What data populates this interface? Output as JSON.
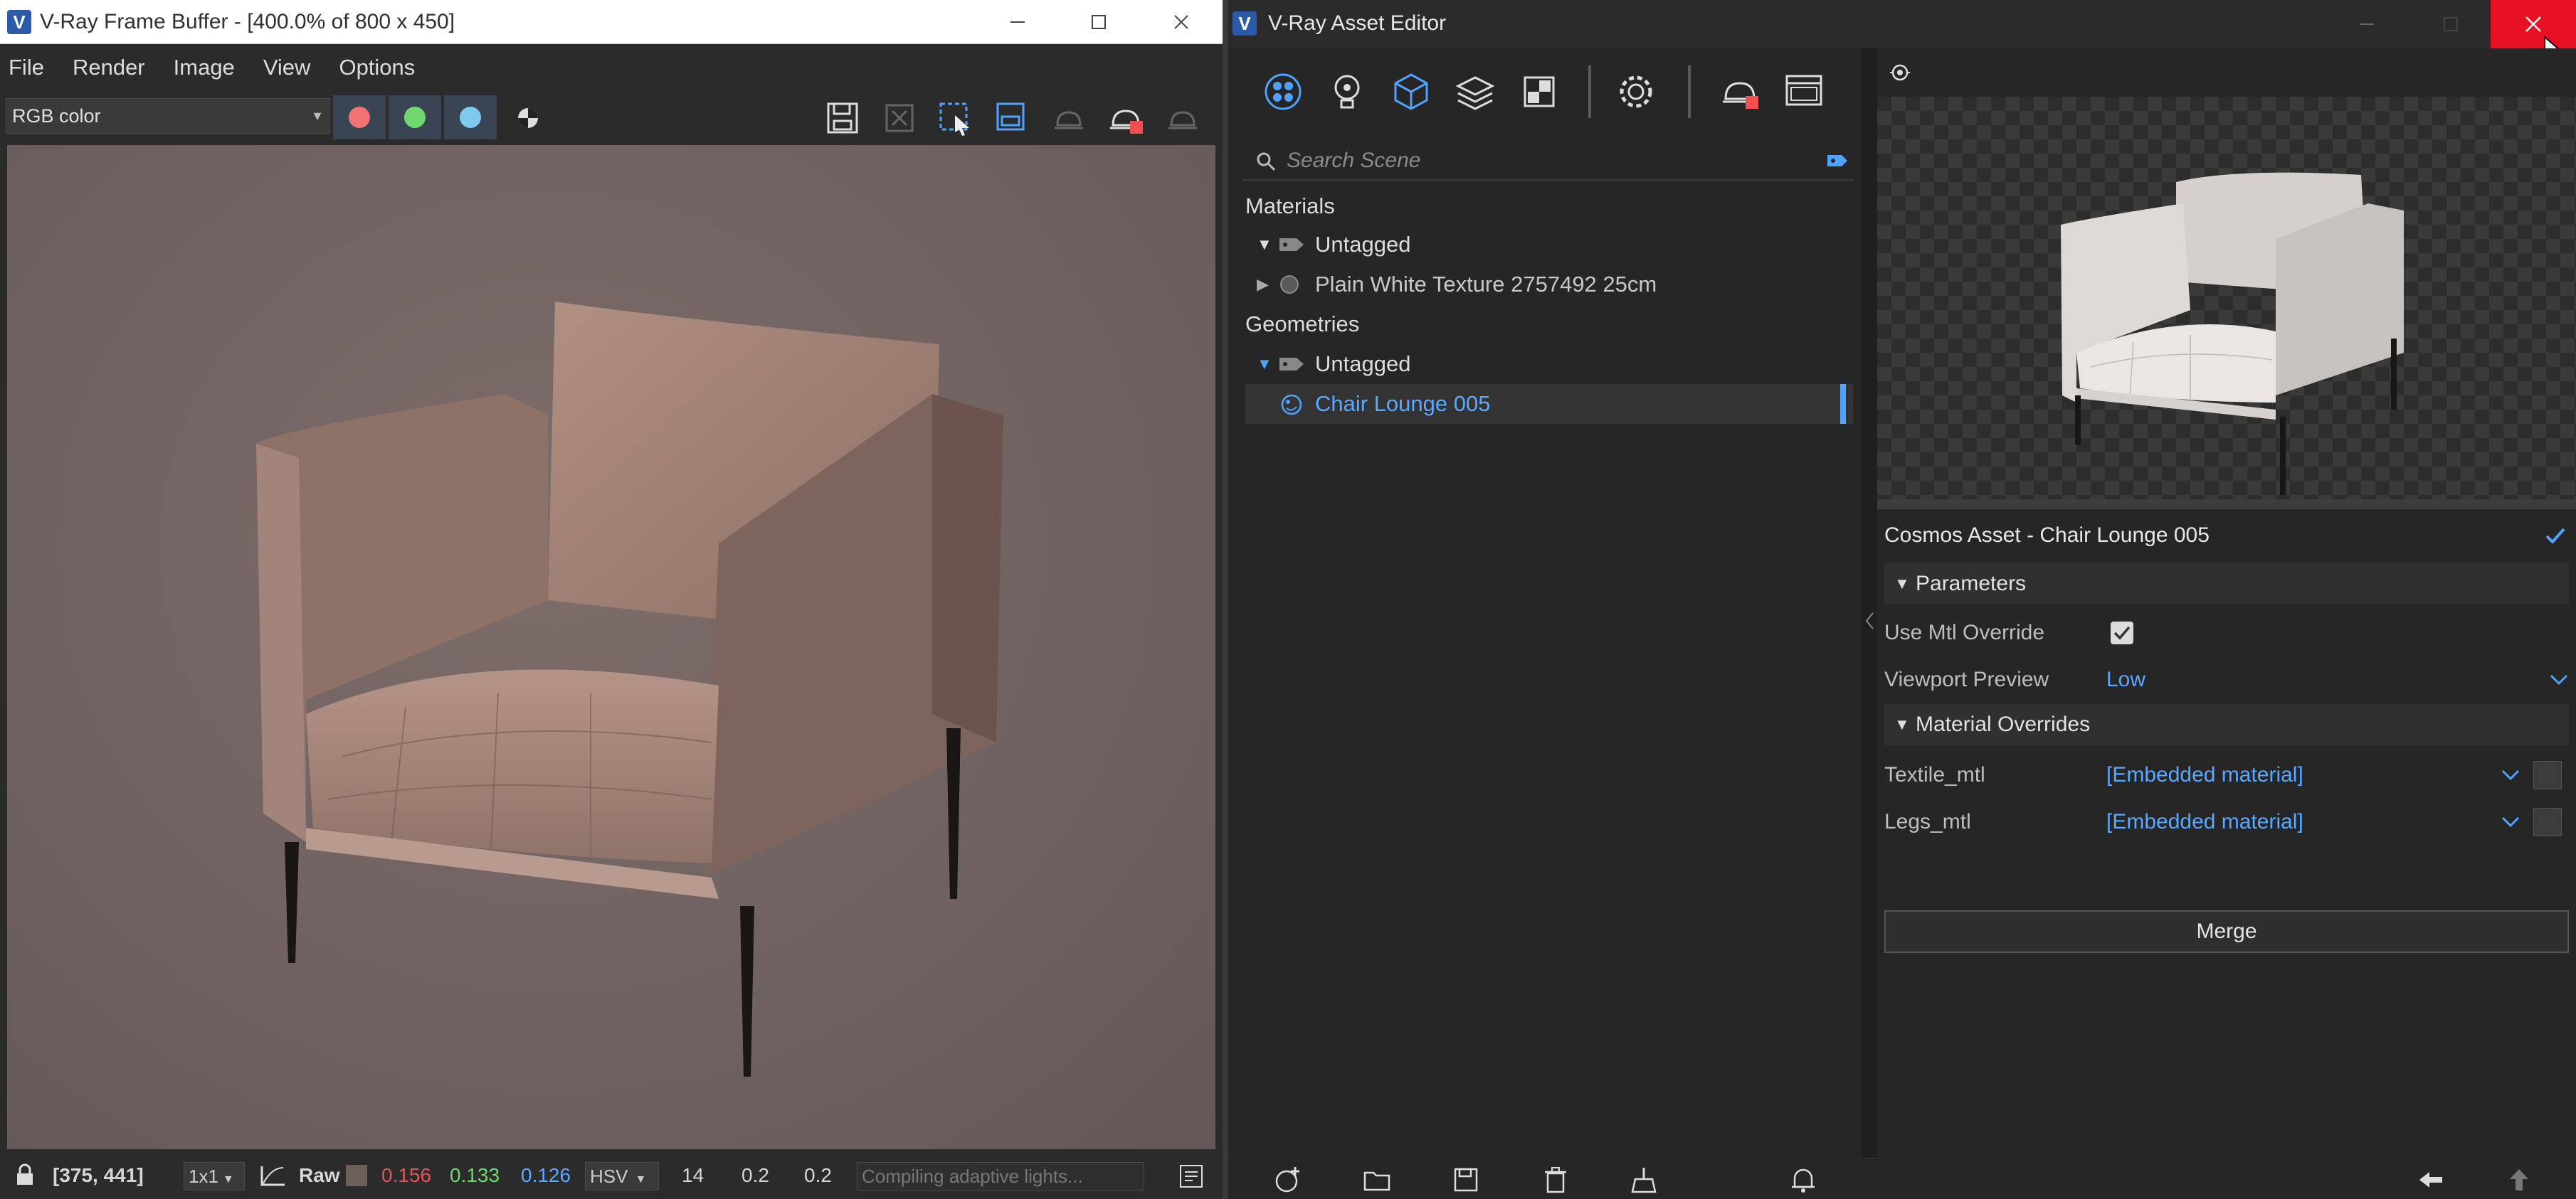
{
  "vfb": {
    "title": "V-Ray Frame Buffer - [400.0% of 800 x 450]",
    "menu": [
      "File",
      "Render",
      "Image",
      "View",
      "Options"
    ],
    "channel": "RGB color",
    "status": {
      "coords": "[375, 441]",
      "zoom": "1x1",
      "raw_label": "Raw",
      "r": "0.156",
      "g": "0.133",
      "b": "0.126",
      "color_mode": "HSV",
      "h": "14",
      "s": "0.2",
      "v": "0.2",
      "message": "Compiling adaptive lights..."
    },
    "colors": {
      "red_dot": "#f07272",
      "green_dot": "#6fd96f",
      "blue_dot": "#7fc9f0",
      "r_text": "#e05555",
      "g_text": "#6fd96f",
      "b_text": "#5aa8ff"
    }
  },
  "ae": {
    "title": "V-Ray Asset Editor",
    "search_placeholder": "Search Scene",
    "tree": {
      "materials": "Materials",
      "mat_tag": "Untagged",
      "mat_item": "Plain White Texture 2757492 25cm",
      "geometries": "Geometries",
      "geo_tag": "Untagged",
      "geo_item": "Chair Lounge 005"
    },
    "props": {
      "title": "Cosmos Asset - Chair Lounge 005",
      "parameters": "Parameters",
      "use_mtl_override": "Use Mtl Override",
      "use_mtl_override_checked": true,
      "viewport_preview": "Viewport Preview",
      "viewport_preview_value": "Low",
      "material_overrides": "Material Overrides",
      "textile": "Textile_mtl",
      "textile_value": "[Embedded material]",
      "legs": "Legs_mtl",
      "legs_value": "[Embedded material]",
      "merge": "Merge"
    },
    "accent": "#4fa3ff"
  }
}
